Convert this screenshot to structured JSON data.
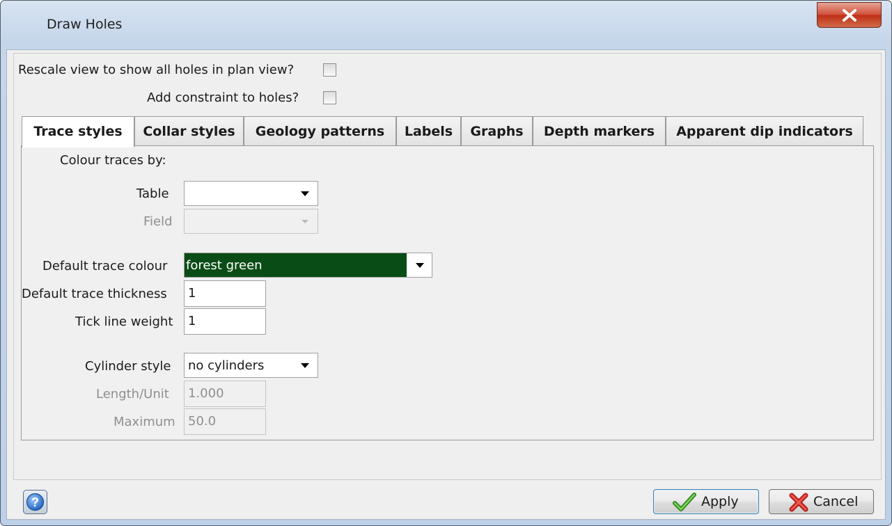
{
  "window": {
    "title": "Draw Holes",
    "close_icon": "close-icon"
  },
  "options": {
    "rescale_label": "Rescale view to show all holes in plan view?",
    "rescale_checked": false,
    "constraint_label": "Add constraint to holes?",
    "constraint_checked": false
  },
  "tabs": [
    {
      "label": "Trace styles",
      "active": true
    },
    {
      "label": "Collar styles"
    },
    {
      "label": "Geology patterns"
    },
    {
      "label": "Labels"
    },
    {
      "label": "Graphs"
    },
    {
      "label": "Depth markers"
    },
    {
      "label": "Apparent dip indicators"
    }
  ],
  "trace": {
    "colour_by_heading": "Colour traces by:",
    "table_label": "Table",
    "table_value": "",
    "field_label": "Field",
    "field_value": "",
    "default_colour_label": "Default trace colour",
    "default_colour_value": "forest green",
    "default_colour_hex": "#0a4c15",
    "thickness_label": "Default trace thickness",
    "thickness_value": "1",
    "tick_label": "Tick line weight",
    "tick_value": "1",
    "cylinder_label": "Cylinder style",
    "cylinder_value": "no cylinders",
    "length_label": "Length/Unit",
    "length_value": "1.000",
    "maximum_label": "Maximum",
    "maximum_value": "50.0"
  },
  "footer": {
    "help_icon": "help-icon",
    "apply_label": "Apply",
    "apply_icon": "checkmark-icon",
    "cancel_label": "Cancel",
    "cancel_icon": "cross-icon"
  }
}
